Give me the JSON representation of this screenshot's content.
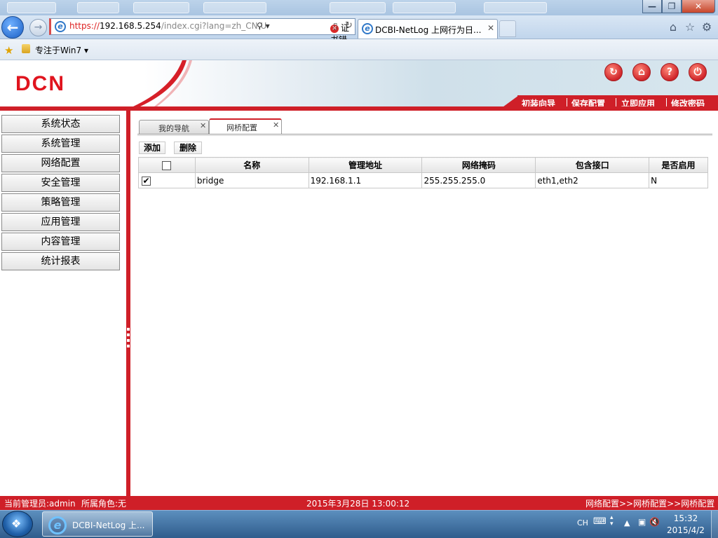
{
  "browser": {
    "address_url_https": "https://",
    "address_url_host": "192.168.5.254",
    "address_url_rest": "/index.cgi?lang=zh_CN.U",
    "cert_error": "证书错误",
    "tab_title": "DCBI-NetLog 上网行为日...",
    "tab_close": "✕",
    "favorites_link": "专注于Win7 ▾",
    "window_controls": [
      "—",
      "❐",
      "✕"
    ]
  },
  "app": {
    "logo": "DCN",
    "header_links": [
      "初装向导",
      "保存配置",
      "立即应用",
      "修改密码"
    ],
    "round_icons": [
      "refresh-icon",
      "home-icon",
      "help-icon",
      "logout-icon"
    ]
  },
  "sidebar": {
    "items": [
      {
        "label": "系统状态"
      },
      {
        "label": "系统管理"
      },
      {
        "label": "网络配置"
      },
      {
        "label": "安全管理"
      },
      {
        "label": "策略管理"
      },
      {
        "label": "应用管理"
      },
      {
        "label": "内容管理"
      },
      {
        "label": "统计报表"
      }
    ]
  },
  "content": {
    "tabs": [
      {
        "label": "我的导航",
        "active": false
      },
      {
        "label": "网桥配置",
        "active": true
      }
    ],
    "tab_close": "✕",
    "actions": {
      "add": "添加",
      "delete": "删除"
    },
    "table": {
      "headers": [
        "名称",
        "管理地址",
        "网络掩码",
        "包含接口",
        "是否启用"
      ],
      "rows": [
        {
          "checked": true,
          "check_mark": "✔",
          "name": "bridge",
          "mgmt_addr": "192.168.1.1",
          "netmask": "255.255.255.0",
          "interfaces": "eth1,eth2",
          "enabled": "N"
        }
      ]
    }
  },
  "statusbar": {
    "admin": "当前管理员:admin",
    "role": "所属角色:无",
    "datetime": "2015年3月28日 13:00:12",
    "breadcrumb": "网络配置>>网桥配置>>网桥配置"
  },
  "taskbar": {
    "item_label": "DCBI-NetLog 上...",
    "lang": "CH",
    "time": "15:32",
    "date": "2015/4/2"
  },
  "colors": {
    "accent": "#cf1f28",
    "logo": "#e0141e",
    "taskbar": "#2f5c8c"
  }
}
